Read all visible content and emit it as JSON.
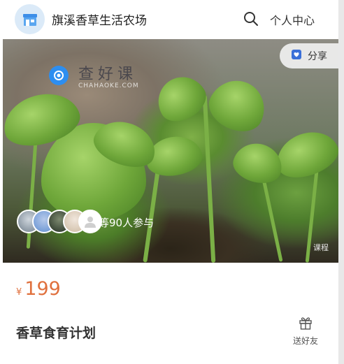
{
  "header": {
    "shop_name": "旗溪香草生活农场",
    "user_center": "个人中心"
  },
  "banner": {
    "share_label": "分享",
    "watermark_title": "查好课",
    "watermark_sub": "CHAHAOKE.COM",
    "participants": "等90人参与",
    "course_badge": "课程"
  },
  "product": {
    "currency": "¥",
    "price": "199",
    "title": "香草食育计划",
    "gift_label": "送好友"
  },
  "colors": {
    "price": "#e0703d",
    "logo_bg": "#dbeaf8",
    "logo_accent": "#2d8ef0"
  },
  "icons": [
    "shop-logo-icon",
    "search-icon",
    "share-icon",
    "gift-icon"
  ]
}
